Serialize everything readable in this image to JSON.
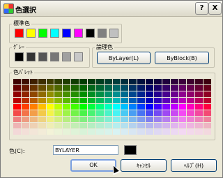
{
  "window": {
    "title": "色選択"
  },
  "titlebar": {
    "help_label": "?",
    "close_label": "X"
  },
  "standard": {
    "label": "標準色",
    "swatches": [
      "#ff0000",
      "#ffff00",
      "#00ff00",
      "#00ffff",
      "#0000ff",
      "#ff00ff",
      "#000000",
      "#808080",
      "#c0c0c0"
    ]
  },
  "gray": {
    "label": "ｸﾞﾚｰ",
    "swatches": [
      "#000000",
      "#333333",
      "#555555",
      "#777777",
      "#a0a0a0",
      "#c8c8c8"
    ]
  },
  "logical": {
    "label": "論理色",
    "bylayer_label": "ByLayer(L)",
    "byblock_label": "ByBlock(B)"
  },
  "palette": {
    "label": "色ﾊﾟﾚｯﾄ"
  },
  "color_field": {
    "label": "色(C):",
    "value": "BYLAYER",
    "preview_color": "#000000"
  },
  "buttons": {
    "ok": "OK",
    "cancel": "ｷｬﾝｾﾙ",
    "help": "ﾍﾙﾌﾟ(H)"
  }
}
